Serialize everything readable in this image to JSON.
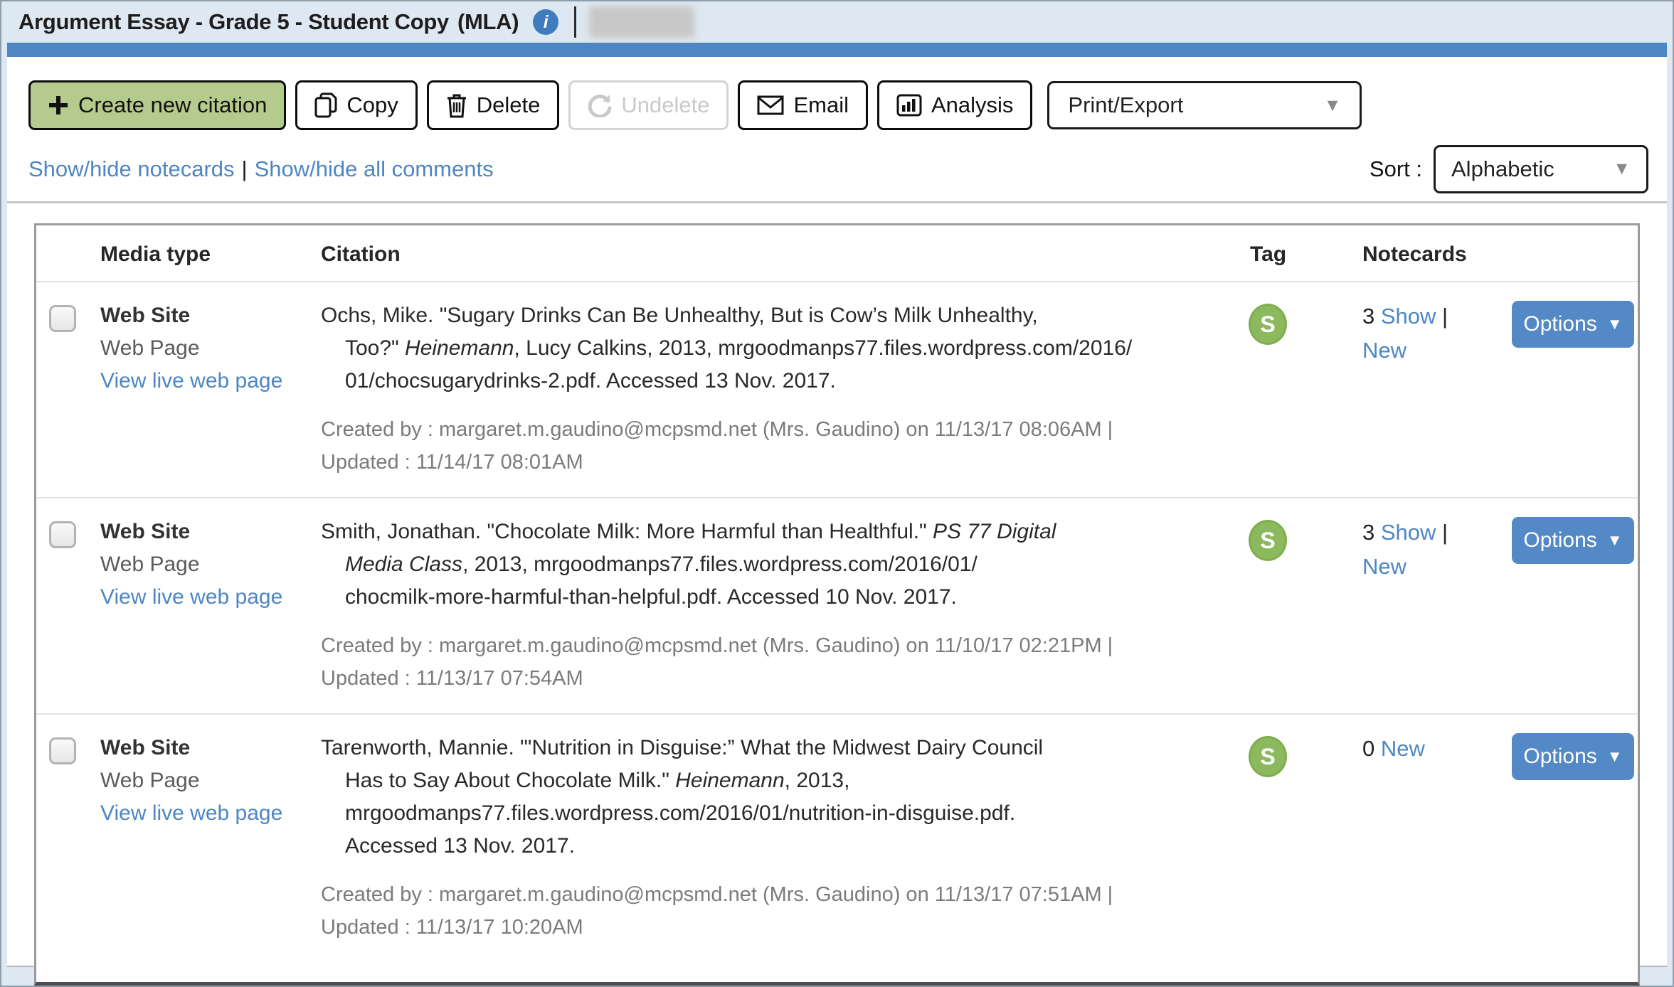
{
  "header": {
    "title": "Argument Essay - Grade 5 - Student Copy",
    "format": "(MLA)",
    "info_glyph": "i"
  },
  "toolbar": {
    "create_new_citation": "Create new citation",
    "copy": "Copy",
    "delete": "Delete",
    "undelete": "Undelete",
    "email": "Email",
    "analysis": "Analysis",
    "print_export": "Print/Export"
  },
  "icons": {
    "plus": "+",
    "caret_down": "▼",
    "options_caret": "▼",
    "pipe": "|"
  },
  "subbar": {
    "show_hide_notecards": "Show/hide notecards",
    "show_hide_comments": "Show/hide all comments",
    "sort_label": "Sort :",
    "sort_value": "Alphabetic"
  },
  "table": {
    "headers": {
      "media_type": "Media type",
      "citation": "Citation",
      "tag": "Tag",
      "notecards": "Notecards"
    },
    "rows": [
      {
        "media_type": "Web Site",
        "media_subtype": "Web Page",
        "view_link": "View live web page",
        "citation_lines": [
          [
            {
              "t": "Ochs, Mike. \"Sugary Drinks Can Be Unhealthy, But is Cow’s Milk Unhealthy,"
            }
          ],
          [
            {
              "t": "Too?\" "
            },
            {
              "t": "Heinemann",
              "i": true
            },
            {
              "t": ", Lucy Calkins, 2013, mrgoodmanps77.files.wordpress.com/2016/"
            }
          ],
          [
            {
              "t": "01/chocsugarydrinks-2.pdf. Accessed 13 Nov. 2017."
            }
          ]
        ],
        "meta_line1": "Created by : margaret.m.gaudino@mcpsmd.net (Mrs. Gaudino) on 11/13/17 08:06AM |",
        "meta_line2": "Updated : 11/14/17 08:01AM",
        "tag_letter": "S",
        "notecard_count": "3",
        "show_link": "Show",
        "new_link": "New",
        "options_label": "Options"
      },
      {
        "media_type": "Web Site",
        "media_subtype": "Web Page",
        "view_link": "View live web page",
        "citation_lines": [
          [
            {
              "t": "Smith, Jonathan. \"Chocolate Milk: More Harmful than Healthful.\" "
            },
            {
              "t": "PS 77 Digital",
              "i": true
            }
          ],
          [
            {
              "t": "Media Class",
              "i": true
            },
            {
              "t": ", 2013, mrgoodmanps77.files.wordpress.com/2016/01/"
            }
          ],
          [
            {
              "t": "chocmilk-more-harmful-than-helpful.pdf. Accessed 10 Nov. 2017."
            }
          ]
        ],
        "meta_line1": "Created by : margaret.m.gaudino@mcpsmd.net (Mrs. Gaudino) on 11/10/17 02:21PM |",
        "meta_line2": "Updated : 11/13/17 07:54AM",
        "tag_letter": "S",
        "notecard_count": "3",
        "show_link": "Show",
        "new_link": "New",
        "options_label": "Options"
      },
      {
        "media_type": "Web Site",
        "media_subtype": "Web Page",
        "view_link": "View live web page",
        "citation_lines": [
          [
            {
              "t": "Tarenworth, Mannie. \"'Nutrition in Disguise:” What the Midwest Dairy Council"
            }
          ],
          [
            {
              "t": "Has to Say About Chocolate Milk.\" "
            },
            {
              "t": "Heinemann",
              "i": true
            },
            {
              "t": ", 2013,"
            }
          ],
          [
            {
              "t": "mrgoodmanps77.files.wordpress.com/2016/01/nutrition-in-disguise.pdf."
            }
          ],
          [
            {
              "t": "Accessed 13 Nov. 2017."
            }
          ]
        ],
        "meta_line1": "Created by : margaret.m.gaudino@mcpsmd.net (Mrs. Gaudino) on 11/13/17 07:51AM |",
        "meta_line2": "Updated : 11/13/17 10:20AM",
        "tag_letter": "S",
        "notecard_count": "0",
        "new_link": "New",
        "options_label": "Options"
      }
    ]
  }
}
